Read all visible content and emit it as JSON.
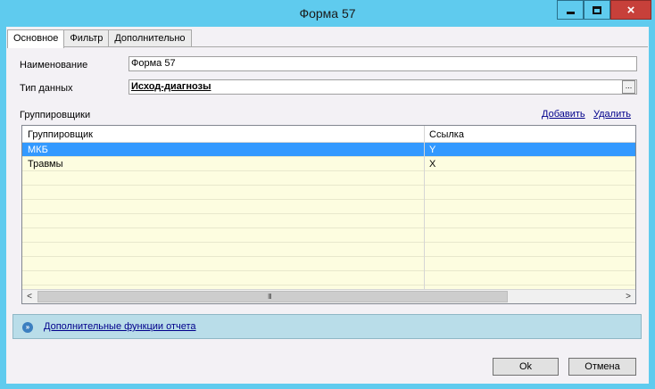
{
  "window": {
    "title": "Форма 57",
    "close_glyph": "×"
  },
  "tabs": [
    {
      "label": "Основное"
    },
    {
      "label": "Фильтр"
    },
    {
      "label": "Дополнительно"
    }
  ],
  "form": {
    "name_label": "Наименование",
    "name_value": "Форма 57",
    "datatype_label": "Тип данных",
    "datatype_value": "Исход-диагнозы",
    "datatype_button": "..."
  },
  "groupers": {
    "label": "Группировщики",
    "add_link": "Добавить",
    "delete_link": "Удалить",
    "columns": [
      "Группировщик",
      "Ссылка"
    ],
    "rows": [
      {
        "grouper": "МКБ",
        "ref": "Y",
        "selected": true
      },
      {
        "grouper": "Травмы",
        "ref": "X",
        "selected": false
      }
    ],
    "scroll_left": "<",
    "scroll_right": ">",
    "thumb_grip": "III"
  },
  "extra": {
    "icon": "»",
    "link": "Дополнительные функции отчета"
  },
  "buttons": {
    "ok": "Ok",
    "cancel": "Отмена"
  },
  "colors": {
    "titlebar": "#5fcbee",
    "selection": "#3399ff",
    "grid_bg": "#fdfde0",
    "close": "#c7403a"
  }
}
